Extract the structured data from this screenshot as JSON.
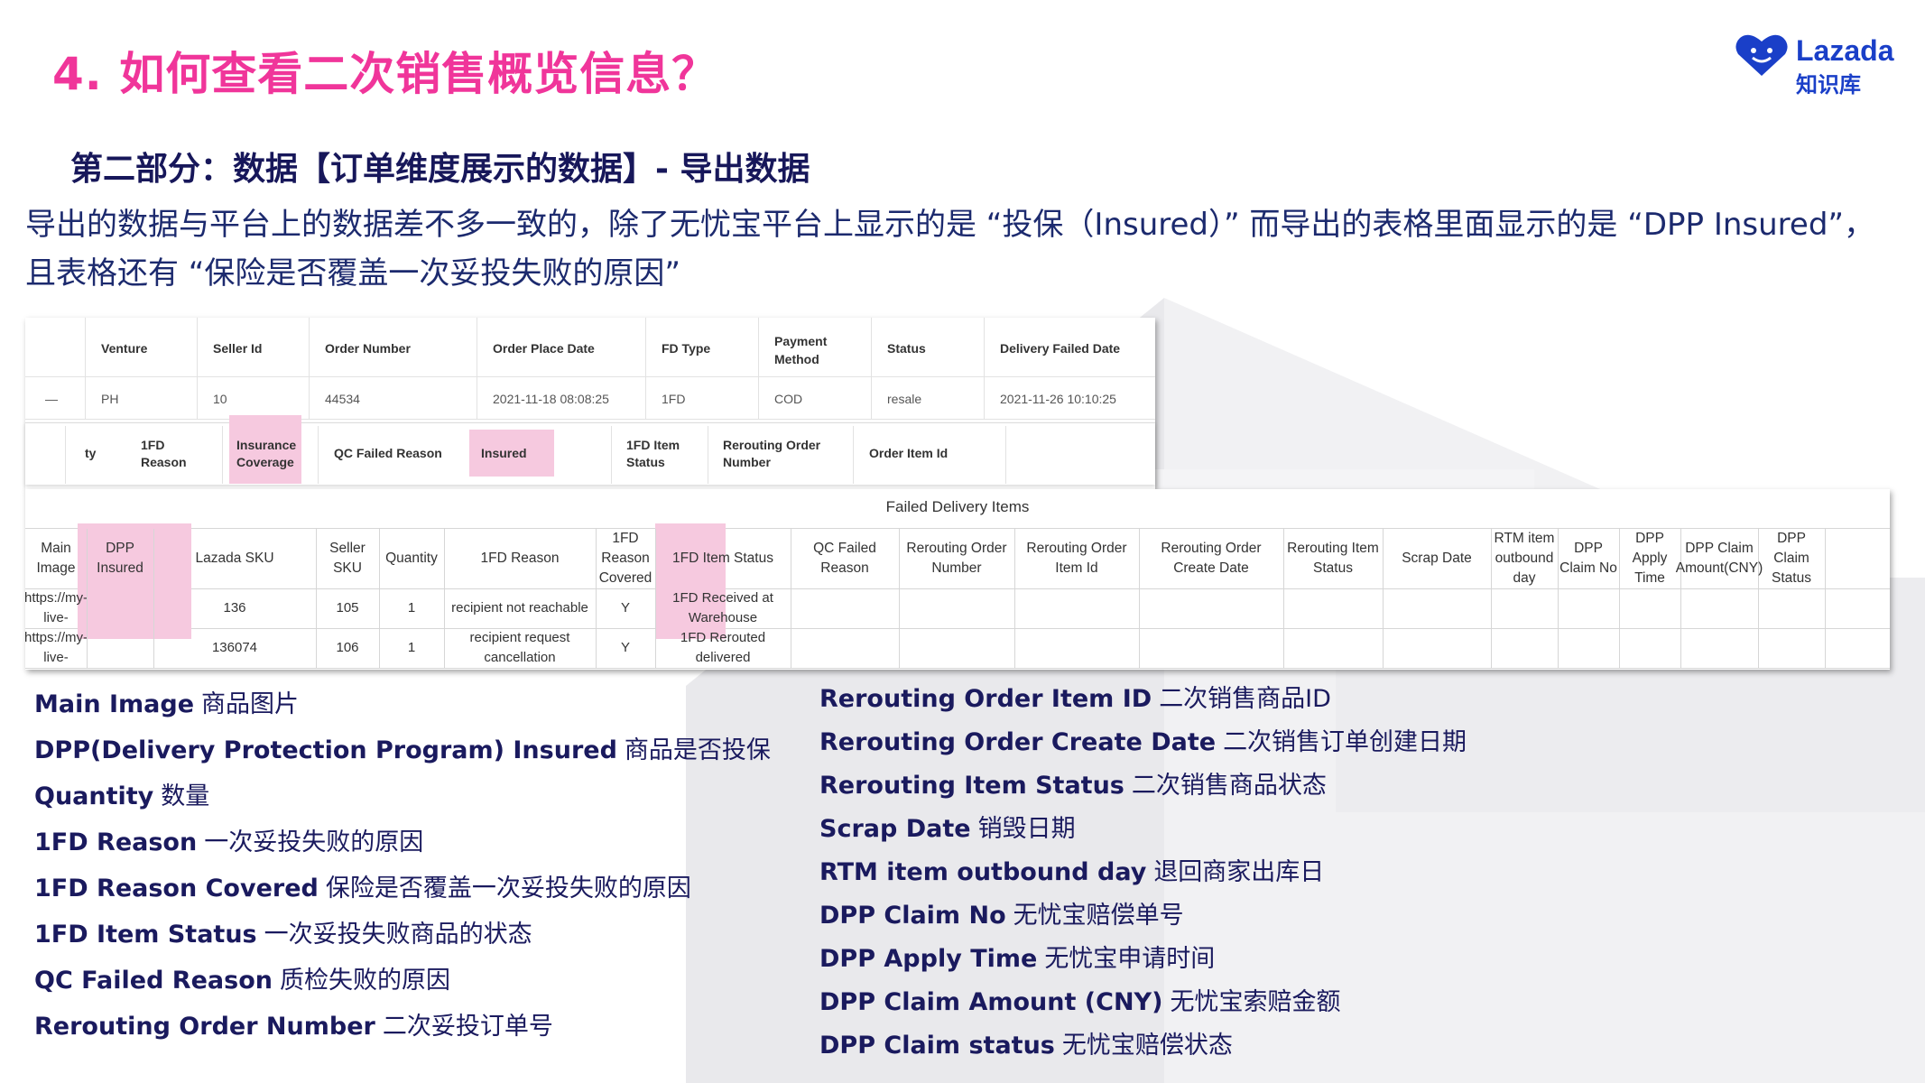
{
  "header": {
    "title": "4. 如何查看二次销售概览信息？",
    "logo_word": "Lazada",
    "logo_sub": "知识库"
  },
  "subtitle": "第二部分：数据【订单维度展示的数据】- 导出数据",
  "paragraph": "导出的数据与平台上的数据差不多一致的，除了无忧宝平台上显示的是 “投保（Insured）” 而导出的表格里面显示的是 “DPP Insured”，且表格还有 “保险是否覆盖一次妥投失败的原因”",
  "platform_table": {
    "headers": [
      "Venture",
      "Seller Id",
      "Order Number",
      "Order Place Date",
      "FD Type",
      "Payment Method",
      "Status",
      "Delivery Failed Date"
    ],
    "row": [
      "—",
      "PH",
      "10",
      "44534",
      "2021-11-18 08:08:25",
      "1FD",
      "COD",
      "resale",
      "2021-11-26 10:10:25"
    ],
    "sub_headers": [
      "ty",
      "1FD Reason",
      "Insurance Coverage",
      "QC Failed Reason",
      "Insured",
      "1FD Item Status",
      "Rerouting Order Number",
      "Order Item Id"
    ]
  },
  "export_table": {
    "title": "Failed Delivery Items",
    "columns": [
      "Main Image",
      "DPP Insured",
      "Lazada SKU",
      "Seller SKU",
      "Quantity",
      "1FD Reason",
      "1FD Reason Covered",
      "1FD Item Status",
      "QC Failed Reason",
      "Rerouting Order Number",
      "Rerouting Order Item Id",
      "Rerouting Order Create Date",
      "Rerouting Item Status",
      "Scrap Date",
      "RTM item outbound day",
      "DPP Claim No",
      "DPP Apply Time",
      "DPP Claim Amount(CNY)",
      "DPP Claim Status"
    ],
    "rows": [
      [
        "https://my-live-",
        "",
        "136",
        "105",
        "1",
        "recipient not reachable",
        "Y",
        "1FD Received at Warehouse",
        "",
        "",
        "",
        "",
        "",
        "",
        "",
        "",
        "",
        "",
        ""
      ],
      [
        "https://my-live-",
        "",
        "136074",
        "106",
        "1",
        "recipient request cancellation",
        "Y",
        "1FD Rerouted delivered",
        "",
        "",
        "",
        "",
        "",
        "",
        "",
        "",
        "",
        "",
        ""
      ]
    ]
  },
  "definitions_left": [
    {
      "term": "Main Image",
      "desc": "商品图片"
    },
    {
      "term": "DPP(Delivery Protection Program) Insured",
      "desc": "商品是否投保"
    },
    {
      "term": "Quantity",
      "desc": "数量"
    },
    {
      "term": "1FD Reason",
      "desc": "一次妥投失败的原因"
    },
    {
      "term": "1FD Reason Covered",
      "desc": "保险是否覆盖一次妥投失败的原因"
    },
    {
      "term": "1FD Item Status",
      "desc": "一次妥投失败商品的状态"
    },
    {
      "term": "QC Failed Reason",
      "desc": "质检失败的原因"
    },
    {
      "term": "Rerouting Order Number",
      "desc": "二次妥投订单号"
    }
  ],
  "definitions_right": [
    {
      "term": "Rerouting Order Item ID",
      "desc": "二次销售商品ID"
    },
    {
      "term": "Rerouting Order Create Date",
      "desc": "二次销售订单创建日期"
    },
    {
      "term": "Rerouting Item Status",
      "desc": "二次销售商品状态"
    },
    {
      "term": "Scrap Date",
      "desc": "销毁日期"
    },
    {
      "term": "RTM item outbound day",
      "desc": "退回商家出库日"
    },
    {
      "term": "DPP Claim No",
      "desc": "无忧宝赔偿单号"
    },
    {
      "term": "DPP Apply Time",
      "desc": "无忧宝申请时间"
    },
    {
      "term": "DPP Claim Amount (CNY)",
      "desc": "无忧宝索赔金额"
    },
    {
      "term": "DPP Claim status",
      "desc": "无忧宝赔偿状态"
    }
  ],
  "colors": {
    "title": "#f0359a",
    "brand": "#1a3fc8",
    "highlight": "#f6c9df"
  }
}
